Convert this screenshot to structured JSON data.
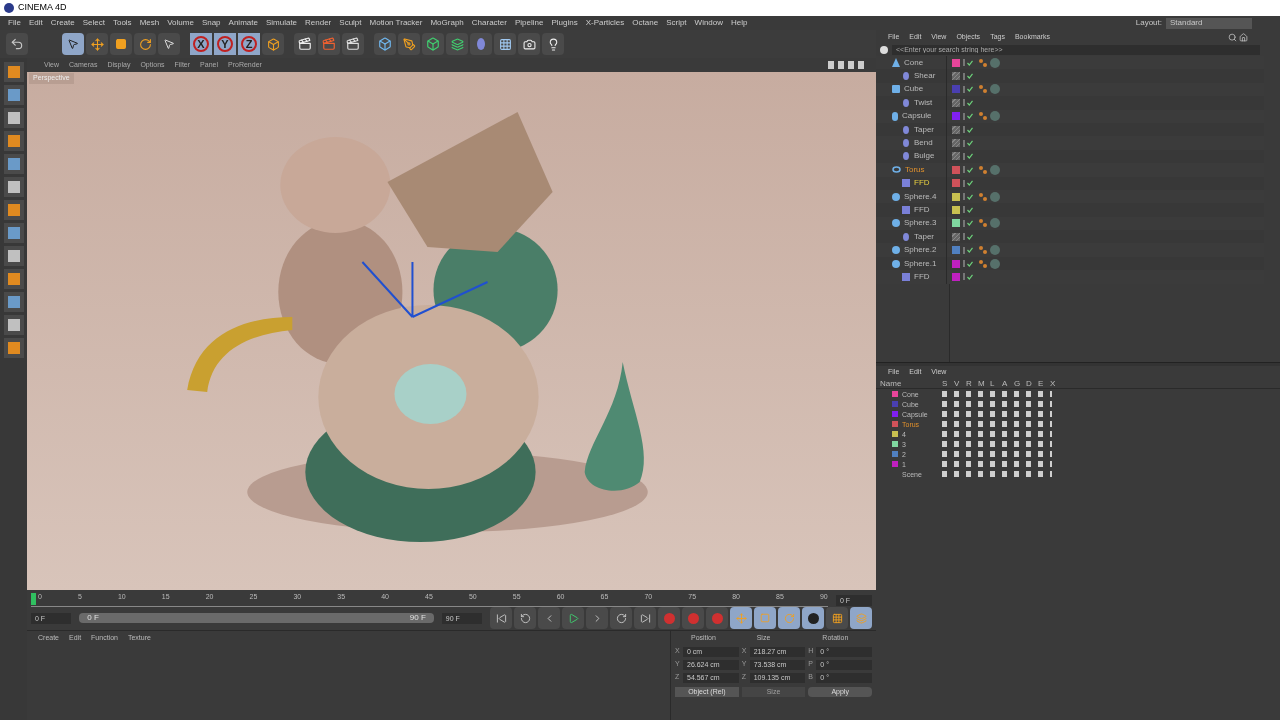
{
  "window": {
    "title": "CINEMA 4D"
  },
  "menu": [
    "File",
    "Edit",
    "Create",
    "Select",
    "Tools",
    "Mesh",
    "Volume",
    "Snap",
    "Animate",
    "Simulate",
    "Render",
    "Sculpt",
    "Motion Tracker",
    "MoGraph",
    "Character",
    "Pipeline",
    "Plugins",
    "X-Particles",
    "Octane",
    "Script",
    "Window",
    "Help"
  ],
  "layout": {
    "label": "Layout:",
    "value": "Standard"
  },
  "axis_locks": [
    {
      "label": "X",
      "selected": true
    },
    {
      "label": "Y",
      "selected": true
    },
    {
      "label": "Z",
      "selected": true
    }
  ],
  "viewport": {
    "menu": [
      "View",
      "Cameras",
      "Display",
      "Options",
      "Filter",
      "Panel",
      "ProRender"
    ],
    "camera": "Perspective",
    "kind": "picture"
  },
  "timeline": {
    "ticks": [
      "0",
      "5",
      "10",
      "15",
      "20",
      "25",
      "30",
      "35",
      "40",
      "45",
      "50",
      "55",
      "60",
      "65",
      "70",
      "75",
      "80",
      "85",
      "90"
    ],
    "current": "0 F",
    "start": "0 F",
    "range_start": "0 F",
    "range_end": "90 F",
    "end": "90 F"
  },
  "material_manager": {
    "menu": [
      "Create",
      "Edit",
      "Function",
      "Texture"
    ]
  },
  "coordinates": {
    "headers": [
      "Position",
      "Size",
      "Rotation"
    ],
    "rows": [
      {
        "pos_axis": "X",
        "pos": "0 cm",
        "size_axis": "X",
        "size": "218.27 cm",
        "rot_axis": "H",
        "rot": "0 °"
      },
      {
        "pos_axis": "Y",
        "pos": "26.624 cm",
        "size_axis": "Y",
        "size": "73.538 cm",
        "rot_axis": "P",
        "rot": "0 °"
      },
      {
        "pos_axis": "Z",
        "pos": "54.567 cm",
        "size_axis": "Z",
        "size": "109.135 cm",
        "rot_axis": "B",
        "rot": "0 °"
      }
    ],
    "mode": "Object (Rel)",
    "size_mode": {
      "label": "Size",
      "disabled": true
    },
    "apply": "Apply"
  },
  "object_manager": {
    "menu": [
      "File",
      "Edit",
      "View",
      "Objects",
      "Tags",
      "Bookmarks"
    ],
    "search": {
      "placeholder": "<<Enter your search string here>>"
    },
    "objects": [
      {
        "name": "Cone",
        "kind": "cone",
        "color": "#e8459a",
        "selected": false,
        "material": true,
        "children": [
          {
            "name": "Shear",
            "kind": "deformer",
            "selected": false,
            "material": false
          }
        ]
      },
      {
        "name": "Cube",
        "kind": "cube",
        "color": "#4a3fb0",
        "selected": false,
        "material": true,
        "children": [
          {
            "name": "Twist",
            "kind": "deformer",
            "selected": false,
            "material": false
          }
        ]
      },
      {
        "name": "Capsule",
        "kind": "capsule",
        "color": "#8020f0",
        "selected": false,
        "material": true,
        "children": [
          {
            "name": "Taper",
            "kind": "deformer",
            "selected": false,
            "material": false
          },
          {
            "name": "Bend",
            "kind": "deformer",
            "selected": false,
            "material": false
          },
          {
            "name": "Bulge",
            "kind": "deformer",
            "selected": false,
            "material": false
          }
        ]
      },
      {
        "name": "Torus",
        "kind": "torus",
        "color": "#d0525a",
        "selected": true,
        "material": true,
        "children": [
          {
            "name": "FFD",
            "kind": "ffd",
            "color": "#d0525a",
            "selected": true,
            "material": false
          }
        ]
      },
      {
        "name": "Sphere.4",
        "kind": "sphere",
        "color": "#c8c050",
        "selected": false,
        "material": true,
        "children": [
          {
            "name": "FFD",
            "kind": "ffd",
            "color": "#c8c050",
            "selected": false,
            "material": false
          }
        ]
      },
      {
        "name": "Sphere.3",
        "kind": "sphere",
        "color": "#80d8a0",
        "selected": false,
        "material": true,
        "children": [
          {
            "name": "Taper",
            "kind": "deformer",
            "selected": false,
            "material": false
          }
        ]
      },
      {
        "name": "Sphere.2",
        "kind": "sphere",
        "color": "#5080c0",
        "selected": false,
        "material": true
      },
      {
        "name": "Sphere.1",
        "kind": "sphere",
        "color": "#c020c0",
        "selected": false,
        "material": true,
        "children": [
          {
            "name": "FFD",
            "kind": "ffd",
            "color": "#c020c0",
            "selected": false,
            "material": false
          }
        ]
      }
    ]
  },
  "layer_manager": {
    "menu": [
      "File",
      "Edit",
      "View"
    ],
    "columns": [
      "Name",
      "S",
      "V",
      "R",
      "M",
      "L",
      "A",
      "G",
      "D",
      "E",
      "X"
    ],
    "layers": [
      {
        "name": "Cone",
        "color": "#e8459a",
        "selected": false
      },
      {
        "name": "Cube",
        "color": "#4a3fb0",
        "selected": false
      },
      {
        "name": "Capsule",
        "color": "#8020f0",
        "selected": false
      },
      {
        "name": "Torus",
        "color": "#d0525a",
        "selected": true
      },
      {
        "name": "4",
        "color": "#c8c050",
        "selected": false
      },
      {
        "name": "3",
        "color": "#80d8a0",
        "selected": false
      },
      {
        "name": "2",
        "color": "#5080c0",
        "selected": false
      },
      {
        "name": "1",
        "color": "#c020c0",
        "selected": false
      },
      {
        "name": "Scene",
        "selected": false
      }
    ]
  }
}
